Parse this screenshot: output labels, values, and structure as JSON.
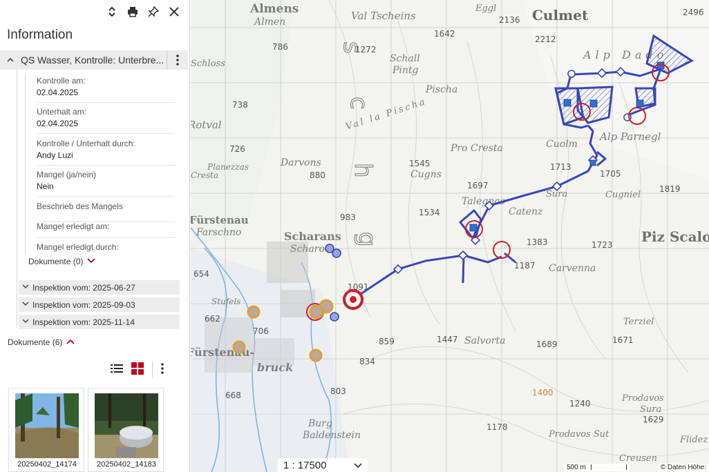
{
  "panel": {
    "title": "Information",
    "group_title": "QS Wasser, Kontrolle: Unterbre...",
    "fields": [
      {
        "label": "Kontrolle am:",
        "value": "02.04.2025"
      },
      {
        "label": "Unterhalt am:",
        "value": "02.04.2025"
      },
      {
        "label": "Kontrolle / Unterhalt durch:",
        "value": "Andy Luzi"
      },
      {
        "label": "Mangel (ja/nein)",
        "value": "Nein"
      },
      {
        "label": "Beschrieb des Mangels",
        "value": ""
      },
      {
        "label": "Mangel erledigt am:",
        "value": ""
      },
      {
        "label": "Mangel erledigt durch:",
        "value": ""
      }
    ],
    "docs_inline": "Dokumente (0)",
    "inspections": [
      "Inspektion vom: 2025-06-27",
      "Inspektion vom: 2025-09-03",
      "Inspektion vom: 2025-11-14"
    ],
    "docs_outer": "Dokumente (6)",
    "thumbnails": [
      "20250402_14174",
      "20250402_14183"
    ]
  },
  "map": {
    "scale_value": "1 : 17500",
    "scalebar_label": "500 m",
    "attribution": "© Daten   Höhe:",
    "place_labels": [
      "Almens",
      "Almen",
      "Val Tscheins",
      "Eggl",
      "Culmet",
      "Alp Dado",
      "Schall",
      "Pintg",
      "Pischa",
      "Val la Pischa",
      "Pro Cresta",
      "Cuolm",
      "Alp Parnegl",
      "Cugns",
      "Darvons",
      "Planezzas",
      "Talegnas",
      "Catenz",
      "Cugniel",
      "Scharans",
      "Scharo",
      "Fürstenau",
      "Farschno",
      "Carvenna",
      "Piz Scalot",
      "Salvorta",
      "Terziel",
      "Fürstenau-",
      "bruck",
      "Burg",
      "Baldenstein",
      "Prodavos",
      "Sura",
      "Prodavos Sut",
      "Creusen",
      "Flidez",
      "Stufels",
      "Schloss",
      "Rotval",
      "Cresta",
      "Sura"
    ],
    "spot_heights": [
      "786",
      "1272",
      "1642",
      "2136",
      "2212",
      "2496",
      "738",
      "726",
      "880",
      "1545",
      "1697",
      "1713",
      "1705",
      "1819",
      "983",
      "1534",
      "1383",
      "1187",
      "1723",
      "654",
      "662",
      "706",
      "1091",
      "859",
      "834",
      "803",
      "668",
      "1447",
      "1689",
      "1671",
      "1400",
      "1240",
      "1629",
      "1178"
    ]
  },
  "colors": {
    "route": "#3746b8",
    "highlight": "#cc1f2b",
    "orange": "#e0a030",
    "water": "#7fb2dd"
  }
}
